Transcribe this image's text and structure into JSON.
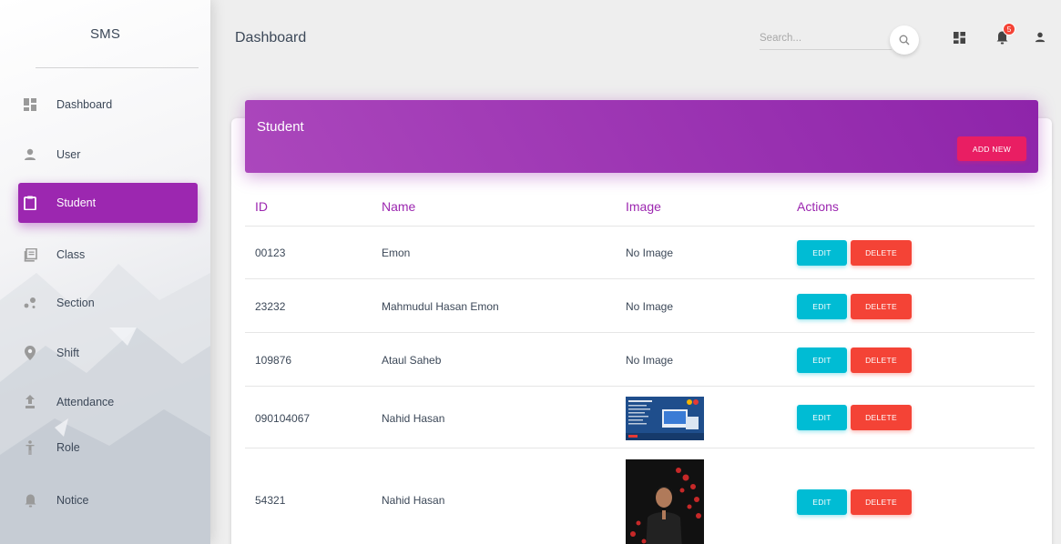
{
  "sidebar": {
    "brand": "SMS",
    "items": [
      {
        "label": "Dashboard",
        "icon": "dashboard-icon",
        "active": false
      },
      {
        "label": "User",
        "icon": "person-icon",
        "active": false
      },
      {
        "label": "Student",
        "icon": "clipboard-icon",
        "active": true
      },
      {
        "label": "Class",
        "icon": "library-books-icon",
        "active": false
      },
      {
        "label": "Section",
        "icon": "bubble-chart-icon",
        "active": false
      },
      {
        "label": "Shift",
        "icon": "location-pin-icon",
        "active": false
      },
      {
        "label": "Attendance",
        "icon": "unarchive-icon",
        "active": false
      },
      {
        "label": "Role",
        "icon": "accessibility-icon",
        "active": false
      },
      {
        "label": "Notice",
        "icon": "notifications-icon",
        "active": false
      }
    ]
  },
  "topbar": {
    "title": "Dashboard",
    "search_placeholder": "Search...",
    "notification_count": "5"
  },
  "card": {
    "title": "Student",
    "add_button": "ADD NEW"
  },
  "table": {
    "headers": {
      "id": "ID",
      "name": "Name",
      "image": "Image",
      "actions": "Actions"
    },
    "rows": [
      {
        "id": "00123",
        "name": "Emon",
        "image": "No Image"
      },
      {
        "id": "23232",
        "name": "Mahmudul Hasan Emon",
        "image": "No Image"
      },
      {
        "id": "109876",
        "name": "Ataul Saheb",
        "image": "No Image"
      },
      {
        "id": "090104067",
        "name": "Nahid Hasan",
        "image": ""
      },
      {
        "id": "54321",
        "name": "Nahid Hasan",
        "image": ""
      }
    ],
    "edit_label": "EDIT",
    "delete_label": "DELETE"
  },
  "colors": {
    "primary": "#9c27b0",
    "accent_pink": "#e91e63",
    "edit_cyan": "#00bcd4",
    "delete_red": "#f44336"
  }
}
